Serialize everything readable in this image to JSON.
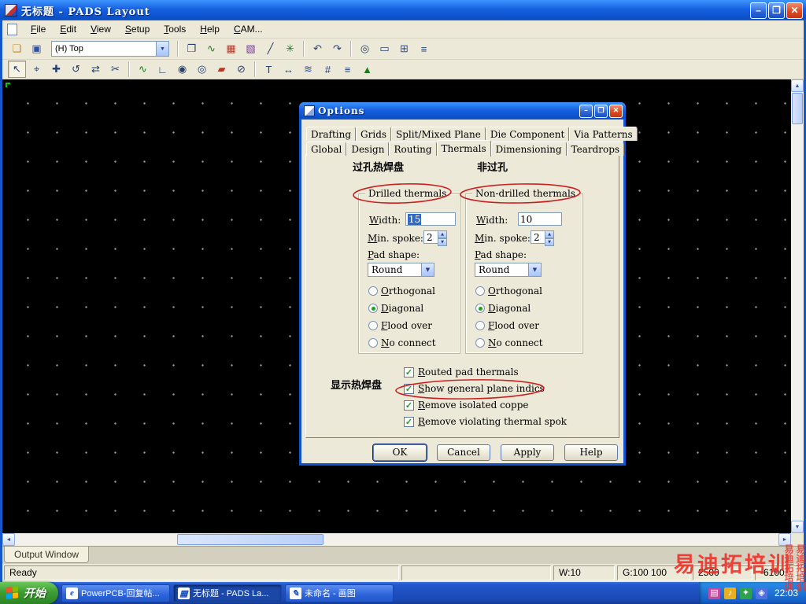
{
  "window": {
    "title": "无标题 - PADS Layout"
  },
  "ui": {
    "min_glyph": "–",
    "max_glyph": "❐",
    "close_glyph": "✕",
    "chevron_down": "▼",
    "spin_up": "▲",
    "spin_down": "▼",
    "check": "✓",
    "arrow_up": "▲",
    "arrow_down": "▼",
    "arrow_left": "◄",
    "arrow_right": "►"
  },
  "menubar": {
    "items": [
      "File",
      "Edit",
      "View",
      "Setup",
      "Tools",
      "Help",
      "CAM..."
    ]
  },
  "toolbar1": {
    "layer_combo": "(H) Top",
    "icons": [
      {
        "name": "open-folder",
        "glyph": "❏"
      },
      {
        "name": "save",
        "glyph": "▣"
      },
      {
        "name": "copy",
        "glyph": "❐"
      },
      {
        "name": "route-mode",
        "glyph": "∿"
      },
      {
        "name": "layers",
        "glyph": "▦"
      },
      {
        "name": "photo-view",
        "glyph": "▧"
      },
      {
        "name": "add-line",
        "glyph": "╱"
      },
      {
        "name": "cluster",
        "glyph": "✳"
      },
      {
        "name": "undo",
        "glyph": "↶"
      },
      {
        "name": "redo",
        "glyph": "↷"
      },
      {
        "name": "zoom",
        "glyph": "◎"
      },
      {
        "name": "board-outline",
        "glyph": "▭"
      },
      {
        "name": "spreadsheet",
        "glyph": "⊞"
      },
      {
        "name": "macro",
        "glyph": "≡"
      }
    ]
  },
  "toolbar2": {
    "icons": [
      {
        "name": "select",
        "glyph": "↖"
      },
      {
        "name": "origin",
        "glyph": "⌖"
      },
      {
        "name": "add",
        "glyph": "✚"
      },
      {
        "name": "rotate",
        "glyph": "↺"
      },
      {
        "name": "mirror",
        "glyph": "⇄"
      },
      {
        "name": "cut",
        "glyph": "✂"
      },
      {
        "name": "route",
        "glyph": "∿"
      },
      {
        "name": "corner",
        "glyph": "∟"
      },
      {
        "name": "via",
        "glyph": "◉"
      },
      {
        "name": "pad",
        "glyph": "◎"
      },
      {
        "name": "copper",
        "glyph": "▰"
      },
      {
        "name": "keepout",
        "glyph": "⊘"
      },
      {
        "name": "text",
        "glyph": "T"
      },
      {
        "name": "dimension",
        "glyph": "↔"
      },
      {
        "name": "hatch",
        "glyph": "≋"
      },
      {
        "name": "grid",
        "glyph": "#"
      },
      {
        "name": "list",
        "glyph": "≡"
      },
      {
        "name": "drc",
        "glyph": "▲"
      }
    ]
  },
  "dialog": {
    "title": "Options",
    "tabs_top": [
      "Drafting",
      "Grids",
      "Split/Mixed Plane",
      "Die Component",
      "Via Patterns"
    ],
    "tabs_bottom": [
      "Global",
      "Design",
      "Routing",
      "Thermals",
      "Dimensioning",
      "Teardrops"
    ],
    "active_tab": "Thermals",
    "annotations": {
      "via": "过孔热焊盘",
      "nonvia": "非过孔",
      "show": "显示热焊盘"
    },
    "drilled": {
      "legend": "Drilled thermals",
      "width_label": "Width:",
      "width_value": "15",
      "width_selected": true,
      "spoke_label": "Min. spoke:",
      "spoke_value": "2",
      "shape_label": "Pad shape:",
      "shape_value": "Round",
      "radios": [
        {
          "label": "Orthogonal",
          "selected": false
        },
        {
          "label": "Diagonal",
          "selected": true
        },
        {
          "label": "Flood over",
          "selected": false
        },
        {
          "label": "No connect",
          "selected": false
        }
      ]
    },
    "nondrilled": {
      "legend": "Non-drilled thermals",
      "width_label": "Width:",
      "width_value": "10",
      "width_selected": false,
      "spoke_label": "Min. spoke:",
      "spoke_value": "2",
      "shape_label": "Pad shape:",
      "shape_value": "Round",
      "radios": [
        {
          "label": "Orthogonal",
          "selected": false
        },
        {
          "label": "Diagonal",
          "selected": true
        },
        {
          "label": "Flood over",
          "selected": false
        },
        {
          "label": "No connect",
          "selected": false
        }
      ]
    },
    "checkboxes": [
      {
        "label": "Routed pad thermals",
        "checked": true
      },
      {
        "label": "Show general plane indics",
        "checked": true
      },
      {
        "label": "Remove isolated coppe",
        "checked": true
      },
      {
        "label": "Remove violating thermal spok",
        "checked": true
      }
    ],
    "buttons": {
      "ok": "OK",
      "cancel": "Cancel",
      "apply": "Apply",
      "help": "Help"
    }
  },
  "output": {
    "tab": "Output Window"
  },
  "statusbar": {
    "ready": "Ready",
    "w": "W:10",
    "g": "G:100 100",
    "x": "2500",
    "y": "-6100"
  },
  "taskbar": {
    "start_label": "开始",
    "tasks": [
      {
        "glyph": "e",
        "label": "PowerPCB-回复帖..."
      },
      {
        "glyph": "▦",
        "label": "无标题 - PADS La..."
      },
      {
        "glyph": "✎",
        "label": "未命名 - 画图"
      }
    ],
    "tray_icons": [
      {
        "name": "input-method",
        "glyph": "▤"
      },
      {
        "name": "volume",
        "glyph": "♪"
      },
      {
        "name": "antivirus",
        "glyph": "✦"
      },
      {
        "name": "network",
        "glyph": "◈"
      }
    ],
    "time": "22:03"
  },
  "watermark": {
    "main": "易迪拓培训",
    "side": "易迪拓培训"
  }
}
